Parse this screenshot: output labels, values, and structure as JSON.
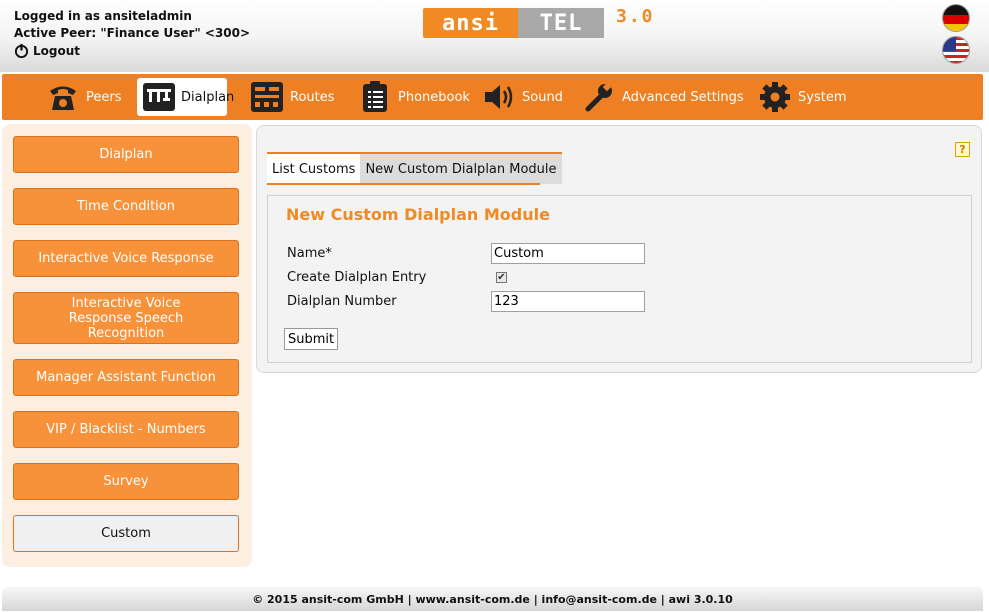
{
  "header": {
    "logged_in": "Logged in as ansiteladmin",
    "active_peer": "Active Peer: \"Finance User\" <300>",
    "logout": "Logout"
  },
  "logo": {
    "part1": "ansi",
    "part2": "TEL",
    "version": "3.0"
  },
  "nav": [
    {
      "label": "Peers",
      "icon": "telephone-icon"
    },
    {
      "label": "Dialplan",
      "icon": "dialplan-icon",
      "active": true
    },
    {
      "label": "Routes",
      "icon": "routes-icon"
    },
    {
      "label": "Phonebook",
      "icon": "phonebook-icon"
    },
    {
      "label": "Sound",
      "icon": "speaker-icon"
    },
    {
      "label": "Advanced Settings",
      "icon": "wrench-icon"
    },
    {
      "label": "System",
      "icon": "gear-icon"
    }
  ],
  "sidebar": [
    {
      "label": "Dialplan"
    },
    {
      "label": "Time Condition"
    },
    {
      "label": "Interactive Voice Response"
    },
    {
      "label": "Interactive Voice Response Speech Recognition"
    },
    {
      "label": "Manager Assistant Function"
    },
    {
      "label": "VIP / Blacklist - Numbers"
    },
    {
      "label": "Survey"
    },
    {
      "label": "Custom",
      "active": true
    }
  ],
  "tabs": [
    {
      "label": "List Customs"
    },
    {
      "label": "New Custom Dialplan Module"
    }
  ],
  "help": "?",
  "form": {
    "title": "New Custom Dialplan Module",
    "name_label": "Name*",
    "name_value": "Custom",
    "create_entry_label": "Create Dialplan Entry",
    "create_entry_checked": true,
    "number_label": "Dialplan Number",
    "number_value": "123",
    "submit_label": "Submit"
  },
  "footer": "© 2015 ansit-com GmbH | www.ansit-com.de | info@ansit-com.de | awi 3.0.10",
  "colors": {
    "accent": "#ee7f22",
    "sidebar_bg": "#fdeee2"
  }
}
